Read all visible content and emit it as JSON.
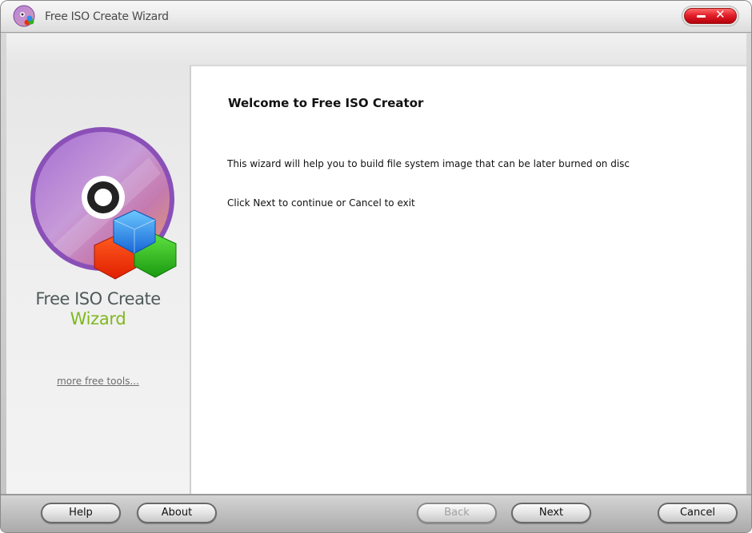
{
  "window": {
    "title": "Free ISO Create Wizard",
    "controls": {
      "minimize_icon": "minimize-icon",
      "close_icon": "close-icon",
      "close_glyph": "✕",
      "accent": "#e3202a"
    }
  },
  "sidebar": {
    "logo_icon": "disc-with-cubes-icon",
    "logo_line1": "Free ISO Create",
    "logo_line2": "Wizard",
    "logo_line2_color": "#7fb81e",
    "more_link": "more free tools..."
  },
  "content": {
    "heading": "Welcome to Free ISO Creator",
    "paragraph1": "This wizard will help you to build file system image that can be later burned on disc",
    "paragraph2": "Click Next to continue or Cancel to exit"
  },
  "footer": {
    "help": "Help",
    "about": "About",
    "back": "Back",
    "back_disabled": true,
    "next": "Next",
    "cancel": "Cancel"
  }
}
